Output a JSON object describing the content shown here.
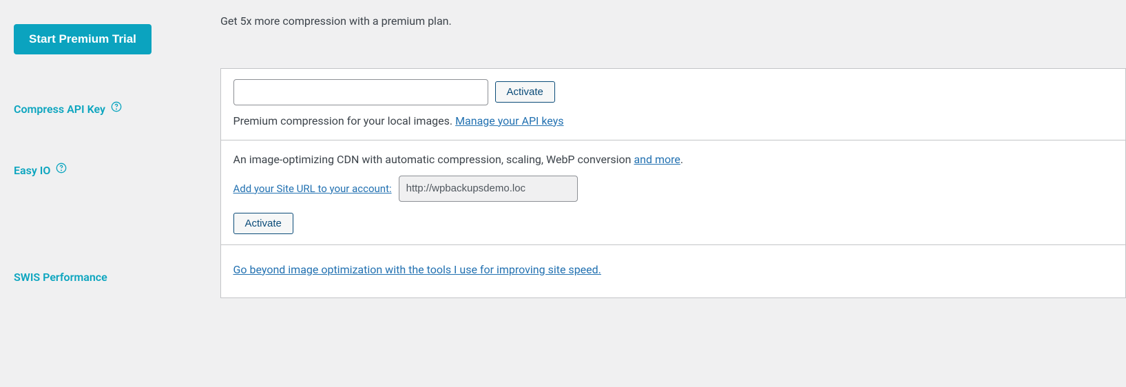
{
  "trial": {
    "button": "Start Premium Trial",
    "description": "Get 5x more compression with a premium plan."
  },
  "compress": {
    "label": "Compress API Key",
    "activate": "Activate",
    "description": "Premium compression for your local images. ",
    "manage_link": "Manage your API keys"
  },
  "easyio": {
    "label": "Easy IO",
    "description": "An image-optimizing CDN with automatic compression, scaling, WebP conversion ",
    "and_more": "and more",
    "period": ".",
    "add_url_link": "Add your Site URL to your account:",
    "url_value": "http://wpbackupsdemo.loc",
    "activate": "Activate"
  },
  "swis": {
    "label": "SWIS Performance",
    "link": "Go beyond image optimization with the tools I use for improving site speed."
  }
}
